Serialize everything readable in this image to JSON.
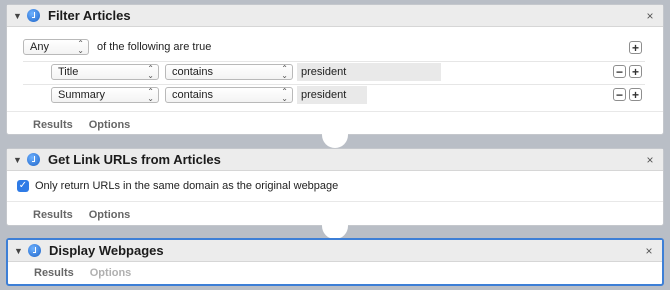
{
  "filter_articles": {
    "title": "Filter Articles",
    "match_select": "Any",
    "match_suffix": "of the following are true",
    "rules": [
      {
        "field": "Title",
        "operator": "contains",
        "value": "president"
      },
      {
        "field": "Summary",
        "operator": "contains",
        "value": "president"
      }
    ],
    "tabs": {
      "results": "Results",
      "options": "Options"
    }
  },
  "get_link_urls": {
    "title": "Get Link URLs from Articles",
    "checkbox_label": "Only return URLs in the same domain as the original webpage",
    "checked": true,
    "tabs": {
      "results": "Results",
      "options": "Options"
    }
  },
  "display_webpages": {
    "title": "Display Webpages",
    "tabs": {
      "results": "Results",
      "options": "Options"
    }
  },
  "icons": {
    "disclosure": "▼",
    "close": "×",
    "add": "+",
    "remove": "−",
    "chevron": "⌃⌄",
    "check": "✓"
  },
  "colors": {
    "selection": "#3d7fd6",
    "checkbox": "#2f7be6",
    "background": "#b9bec6"
  }
}
